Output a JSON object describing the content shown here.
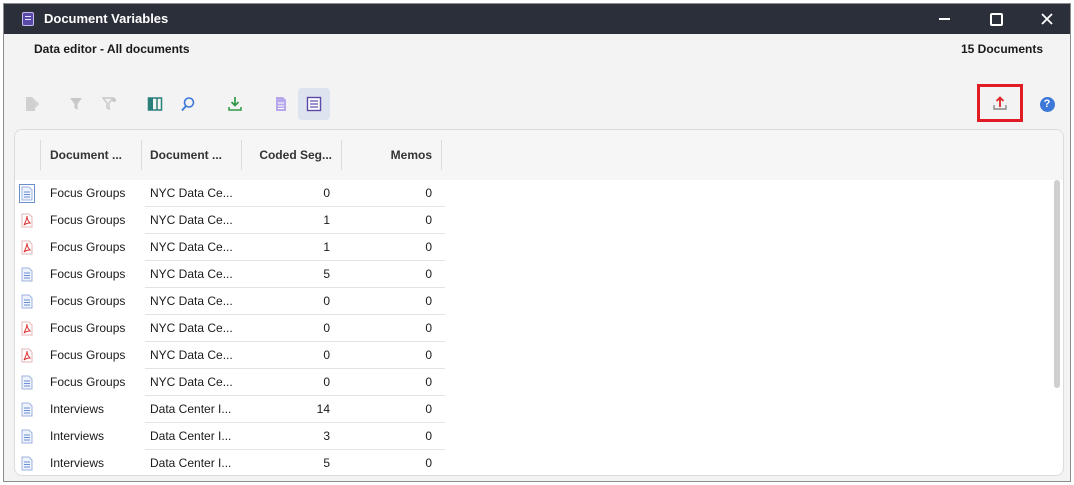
{
  "window": {
    "title": "Document Variables"
  },
  "header": {
    "subtitle": "Data editor - All documents",
    "doc_count": "15 Documents"
  },
  "toolbar": {
    "icons": [
      "export-doc-icon",
      "filter-icon",
      "filter-variable-icon",
      "columns-icon",
      "search-icon",
      "import-icon",
      "doc-icon",
      "list-view-icon",
      "upload-icon",
      "help-icon"
    ],
    "help_glyph": "?"
  },
  "table": {
    "columns": [
      "Document ...",
      "Document ...",
      "Coded Seg...",
      "Memos"
    ],
    "rows": [
      {
        "icon": "text",
        "name": "Focus Groups",
        "group": "NYC Data Ce...",
        "coded": "0",
        "memos": "0"
      },
      {
        "icon": "pdf",
        "name": "Focus Groups",
        "group": "NYC Data Ce...",
        "coded": "1",
        "memos": "0"
      },
      {
        "icon": "pdf",
        "name": "Focus Groups",
        "group": "NYC Data Ce...",
        "coded": "1",
        "memos": "0"
      },
      {
        "icon": "text",
        "name": "Focus Groups",
        "group": "NYC Data Ce...",
        "coded": "5",
        "memos": "0"
      },
      {
        "icon": "text",
        "name": "Focus Groups",
        "group": "NYC Data Ce...",
        "coded": "0",
        "memos": "0"
      },
      {
        "icon": "pdf",
        "name": "Focus Groups",
        "group": "NYC Data Ce...",
        "coded": "0",
        "memos": "0"
      },
      {
        "icon": "pdf",
        "name": "Focus Groups",
        "group": "NYC Data Ce...",
        "coded": "0",
        "memos": "0"
      },
      {
        "icon": "text",
        "name": "Focus Groups",
        "group": "NYC Data Ce...",
        "coded": "0",
        "memos": "0"
      },
      {
        "icon": "text",
        "name": "Interviews",
        "group": "Data Center I...",
        "coded": "14",
        "memos": "0"
      },
      {
        "icon": "text",
        "name": "Interviews",
        "group": "Data Center I...",
        "coded": "3",
        "memos": "0"
      },
      {
        "icon": "text",
        "name": "Interviews",
        "group": "Data Center I...",
        "coded": "5",
        "memos": "0"
      }
    ]
  },
  "colors": {
    "titlebar": "#2b2f3a",
    "highlight": "#e01b24",
    "accent": "#3c78d8"
  }
}
